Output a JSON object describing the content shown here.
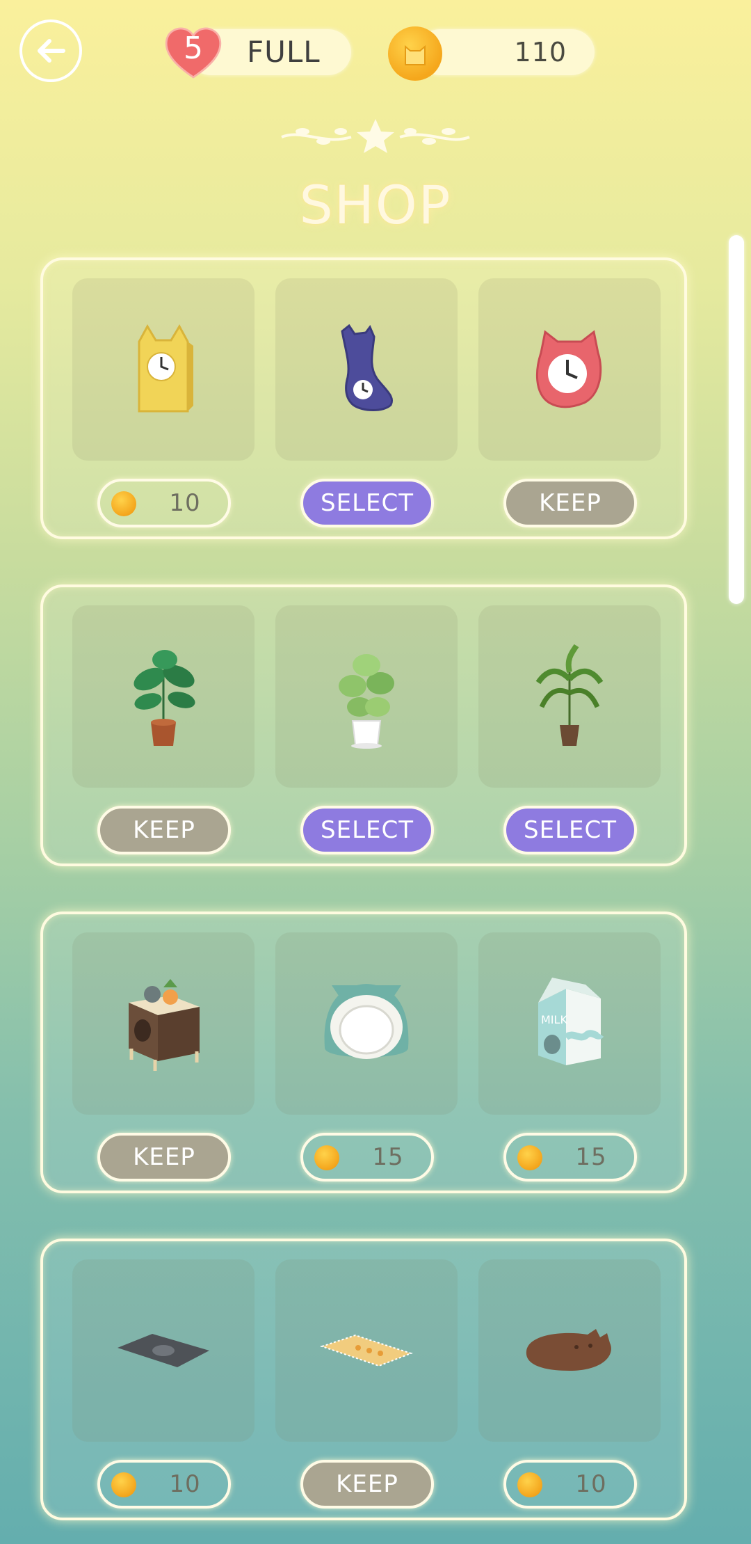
{
  "header": {
    "lives_count": "5",
    "lives_status": "FULL",
    "coins": "110"
  },
  "title": "SHOP",
  "rows": [
    {
      "items": [
        {
          "name": "yellow cat clock",
          "button_type": "price",
          "button": "10"
        },
        {
          "name": "purple cat clock",
          "button_type": "select",
          "button": "SELECT"
        },
        {
          "name": "red cat clock",
          "button_type": "keep",
          "button": "KEEP"
        }
      ]
    },
    {
      "items": [
        {
          "name": "monstera plant",
          "button_type": "keep",
          "button": "KEEP"
        },
        {
          "name": "pothos plant",
          "button_type": "select",
          "button": "SELECT"
        },
        {
          "name": "palm plant",
          "button_type": "select",
          "button": "SELECT"
        }
      ]
    },
    {
      "items": [
        {
          "name": "wooden cat house",
          "button_type": "keep",
          "button": "KEEP"
        },
        {
          "name": "cat igloo bed",
          "button_type": "price",
          "button": "15"
        },
        {
          "name": "milk carton house",
          "button_type": "price",
          "button": "15"
        }
      ],
      "milk_label": "MILK"
    },
    {
      "items": [
        {
          "name": "gray cat mat",
          "button_type": "price",
          "button": "10"
        },
        {
          "name": "yellow fringe rug",
          "button_type": "keep",
          "button": "KEEP"
        },
        {
          "name": "brown cat rug",
          "button_type": "price",
          "button": "10"
        }
      ]
    }
  ],
  "colors": {
    "select": "#8e7be0",
    "keep": "#aaa591",
    "coin": "#f5a71c",
    "heart": "#f06a6a"
  }
}
